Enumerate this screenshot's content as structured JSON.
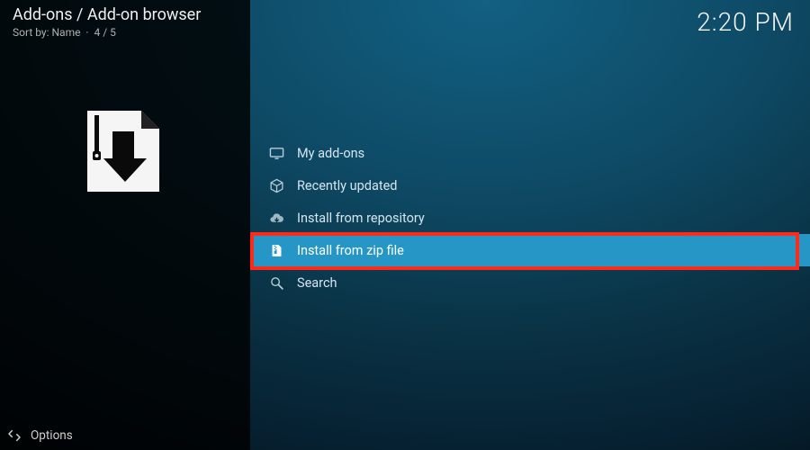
{
  "header": {
    "title": "Add-ons / Add-on browser",
    "sort_label": "Sort by:",
    "sort_value": "Name",
    "position": "4 / 5"
  },
  "clock": "2:20 PM",
  "menu": {
    "items": [
      {
        "label": "My add-ons",
        "selected": false
      },
      {
        "label": "Recently updated",
        "selected": false
      },
      {
        "label": "Install from repository",
        "selected": false
      },
      {
        "label": "Install from zip file",
        "selected": true
      },
      {
        "label": "Search",
        "selected": false
      }
    ]
  },
  "footer": {
    "options_label": "Options"
  }
}
